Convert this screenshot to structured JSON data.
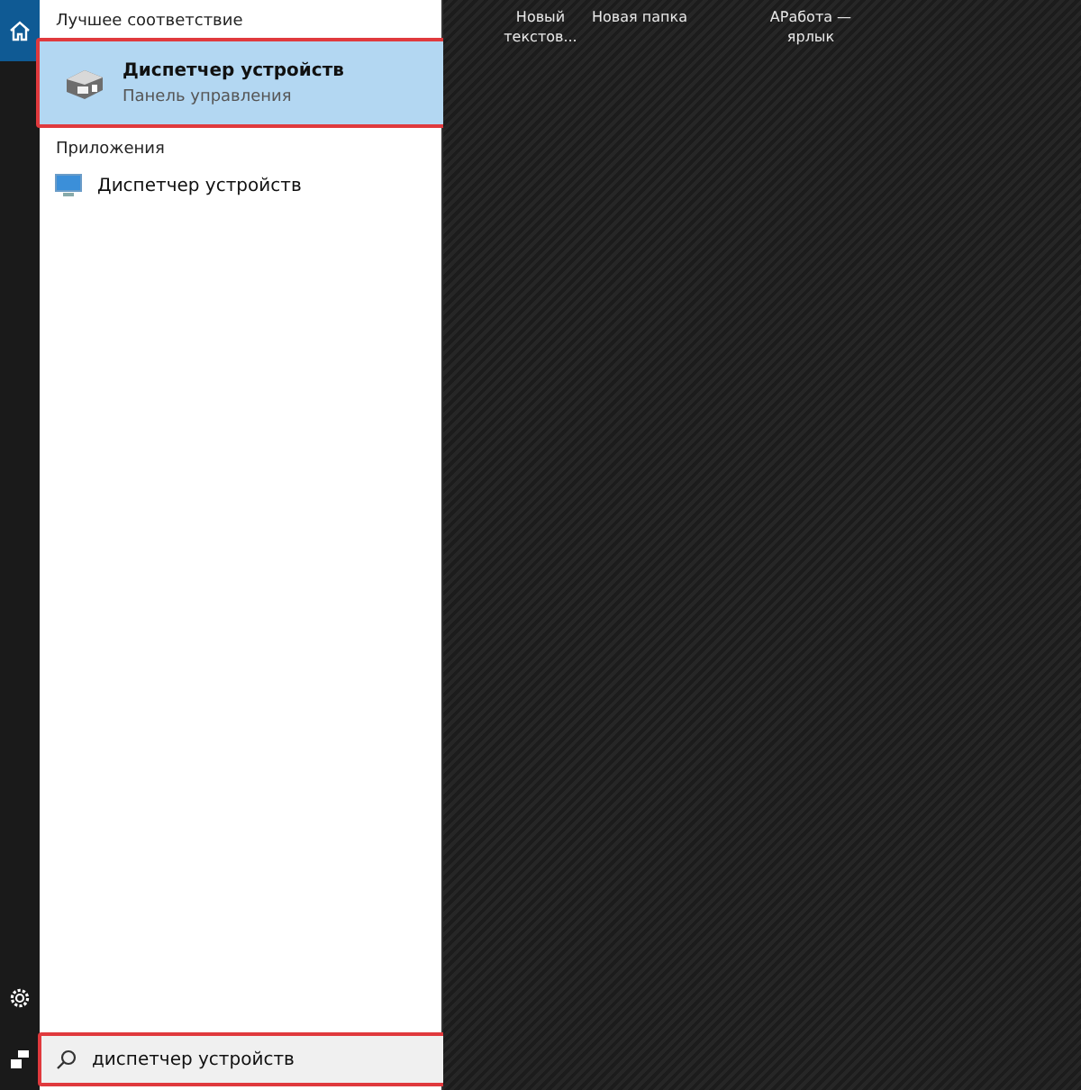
{
  "rail": {
    "items": [
      {
        "kind": "home",
        "selected": true
      },
      {
        "kind": "settings",
        "selected": false
      },
      {
        "kind": "feedback",
        "selected": false
      }
    ]
  },
  "results": {
    "sections": [
      {
        "heading": "Лучшее соответствие",
        "items": [
          {
            "kind": "best",
            "title": "Диспетчер устройств",
            "subtitle": "Панель управления",
            "selected": true
          }
        ]
      },
      {
        "heading": "Приложения",
        "items": [
          {
            "kind": "app",
            "title": "Диспетчер устройств",
            "selected": false
          }
        ]
      }
    ]
  },
  "search": {
    "value": "диспетчер устройств"
  },
  "desktop": {
    "icons": [
      {
        "label": "Новый текстов..."
      },
      {
        "label": "Новая папка"
      },
      {
        "label": "АРабота — ярлык"
      }
    ]
  }
}
